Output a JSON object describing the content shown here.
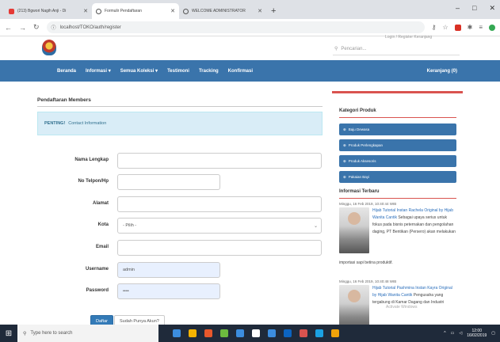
{
  "browser": {
    "tabs": [
      {
        "title": "(213) Bgwori Nagih Anji - Di",
        "fav": "#e53935",
        "active": false
      },
      {
        "title": "Formulir Pendaftaran",
        "fav": "#555555",
        "active": true
      },
      {
        "title": "WELCOME ADMINISTRATOR",
        "fav": "#555555",
        "active": false
      }
    ],
    "new_tab": "+",
    "url": "localhost/TOKO/auth/register",
    "win_minimize": "–",
    "win_maximize": "□",
    "win_close": "✕"
  },
  "header": {
    "top_links": "Login / Register    Keranjang",
    "search_placeholder": "Pencarian..."
  },
  "nav": {
    "items": [
      "Beranda",
      "Informasi ▾",
      "Semua Koleksi ▾",
      "Testimoni",
      "Tracking",
      "Konfirmasi"
    ],
    "cart": "Keranjang (0)"
  },
  "form": {
    "title": "Pendaftaran Members",
    "notice_bold": "PENTING!",
    "notice_text": "Contact Information",
    "fields": [
      {
        "label": "Nama Lengkap",
        "value": ""
      },
      {
        "label": "No Telpon/Hp",
        "value": ""
      },
      {
        "label": "Alamat",
        "value": ""
      },
      {
        "label": "Kota",
        "value": "- Pilih -"
      },
      {
        "label": "Email",
        "value": ""
      },
      {
        "label": "Username",
        "value": "admin"
      },
      {
        "label": "Password",
        "value": "••••"
      }
    ],
    "submit": "Daftar",
    "login_link": "Sudah Punya Akun?"
  },
  "sidebar": {
    "categories_title": "Kategori Produk",
    "categories": [
      "Baju Dewasa",
      "Produk Perlengkapan",
      "Produk Aksesoris",
      "Pakaian Bayi"
    ],
    "news_title": "Informasi Terbaru",
    "posts": [
      {
        "date": "Minggu, 16 Feb 2019, 10:40:44 WIB",
        "link": "Hijab Tutorial Instan Rachela Original by Hijab Wanita Cantik",
        "text": "Sebagai upaya serius untuk fokus pada bisnis peternakan dan pengolahan daging, PT Bentikan (Persero) akan melakukan",
        "more": "importasi sapi betina produktif."
      },
      {
        "date": "Minggu, 16 Feb 2019, 10:40:48 WIB",
        "link": "Hijab Tutorial Pashmina Instan Kayra Original by Hijab Wanita Cantik",
        "text": "Pengusaha yang tergabung di Kamar Dagang dan Industri",
        "more": ""
      }
    ]
  },
  "watermark": "Activate Windows",
  "taskbar": {
    "search_placeholder": "Type here to search",
    "time": "12:00",
    "date": "16/02/2019",
    "icons": [
      "#3c8dde",
      "#f5b400",
      "#e8582c",
      "#6dbb3f",
      "#3c8dde",
      "#ffffff",
      "#3c8dde",
      "#0c64c0",
      "#d9534f",
      "#1ba1e2",
      "#f0a30a"
    ]
  }
}
